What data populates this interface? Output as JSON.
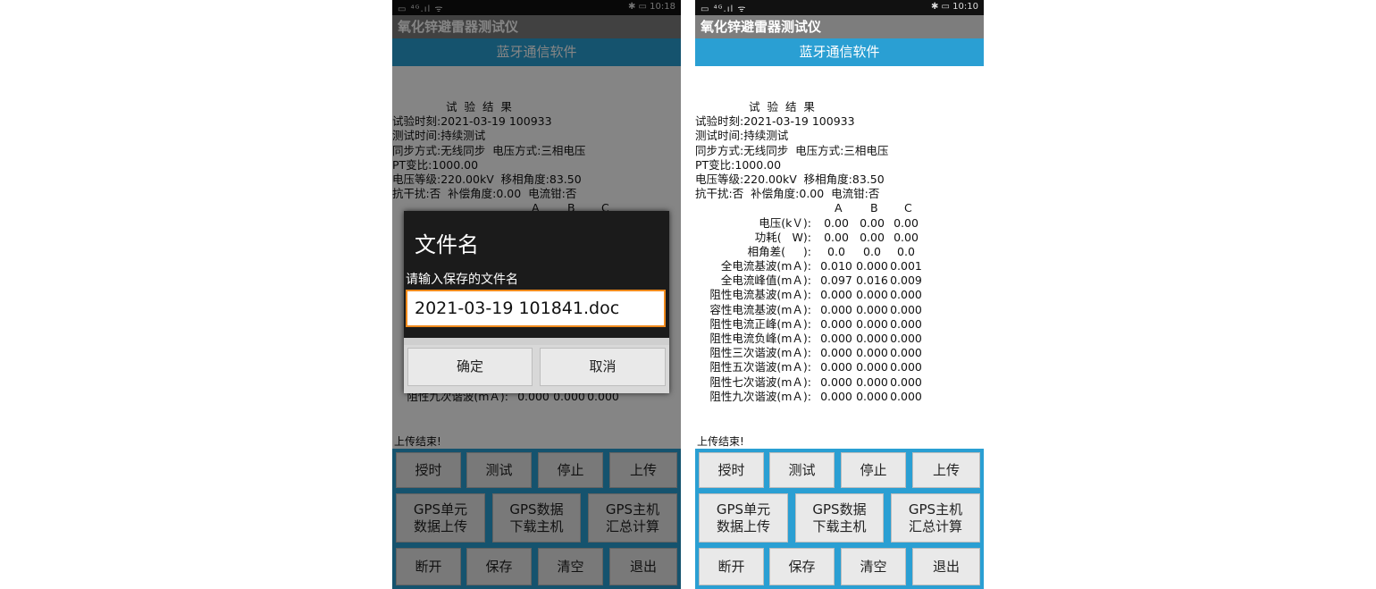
{
  "status_bar": {
    "left_icons": "▭ ⁴ᴳ.ıl ᯤ",
    "left": {
      "time": "10:18"
    },
    "right": {
      "time": "10:10"
    },
    "battery_icon": "bluetooth-battery"
  },
  "app": {
    "title": "氧化锌避雷器测试仪",
    "subtitle": "蓝牙通信软件"
  },
  "results": {
    "heading": "试 验 结 果",
    "lines": [
      "试验时刻:2021-03-19 100933",
      "测试时间:持续测试",
      "同步方式:无线同步  电压方式:三相电压",
      "PT变比:1000.00",
      "电压等级:220.00kV  移相角度:83.50",
      "抗干扰:否  补偿角度:0.00  电流钳:否"
    ],
    "columns": [
      "A",
      "B",
      "C"
    ],
    "rows": [
      {
        "label": "电压(kＶ):",
        "values": [
          "0.00",
          "0.00",
          "0.00"
        ]
      },
      {
        "label": "功耗(   W):",
        "values": [
          "0.00",
          "0.00",
          "0.00"
        ]
      },
      {
        "label": "相角差(     ):",
        "values": [
          "0.0",
          "0.0",
          "0.0"
        ]
      },
      {
        "label": "全电流基波(mＡ):",
        "values": [
          "0.010",
          "0.000",
          "0.001"
        ]
      },
      {
        "label": "全电流峰值(mＡ):",
        "values": [
          "0.097",
          "0.016",
          "0.009"
        ]
      },
      {
        "label": "阻性电流基波(mＡ):",
        "values": [
          "0.000",
          "0.000",
          "0.000"
        ]
      },
      {
        "label": "容性电流基波(mＡ):",
        "values": [
          "0.000",
          "0.000",
          "0.000"
        ]
      },
      {
        "label": "阻性电流正峰(mＡ):",
        "values": [
          "0.000",
          "0.000",
          "0.000"
        ]
      },
      {
        "label": "阻性电流负峰(mＡ):",
        "values": [
          "0.000",
          "0.000",
          "0.000"
        ]
      },
      {
        "label": "阻性三次谐波(mＡ):",
        "values": [
          "0.000",
          "0.000",
          "0.000"
        ]
      },
      {
        "label": "阻性五次谐波(mＡ):",
        "values": [
          "0.000",
          "0.000",
          "0.000"
        ]
      },
      {
        "label": "阻性七次谐波(mＡ):",
        "values": [
          "0.000",
          "0.000",
          "0.000"
        ]
      },
      {
        "label": "阻性九次谐波(mＡ):",
        "values": [
          "0.000",
          "0.000",
          "0.000"
        ]
      }
    ]
  },
  "upload_status": "上传结束!",
  "buttons": {
    "time_sync": "授时",
    "test": "测试",
    "stop": "停止",
    "upload": "上传",
    "gps_unit_upload": [
      "GPS单元",
      "数据上传"
    ],
    "gps_data_download": [
      "GPS数据",
      "下载主机"
    ],
    "gps_host_summary": [
      "GPS主机",
      "汇总计算"
    ],
    "disconnect": "断开",
    "save": "保存",
    "clear": "清空",
    "exit": "退出"
  },
  "dialog": {
    "title": "文件名",
    "prompt": "请输入保存的文件名",
    "input_value": "2021-03-19 101841.doc",
    "ok": "确定",
    "cancel": "取消"
  }
}
